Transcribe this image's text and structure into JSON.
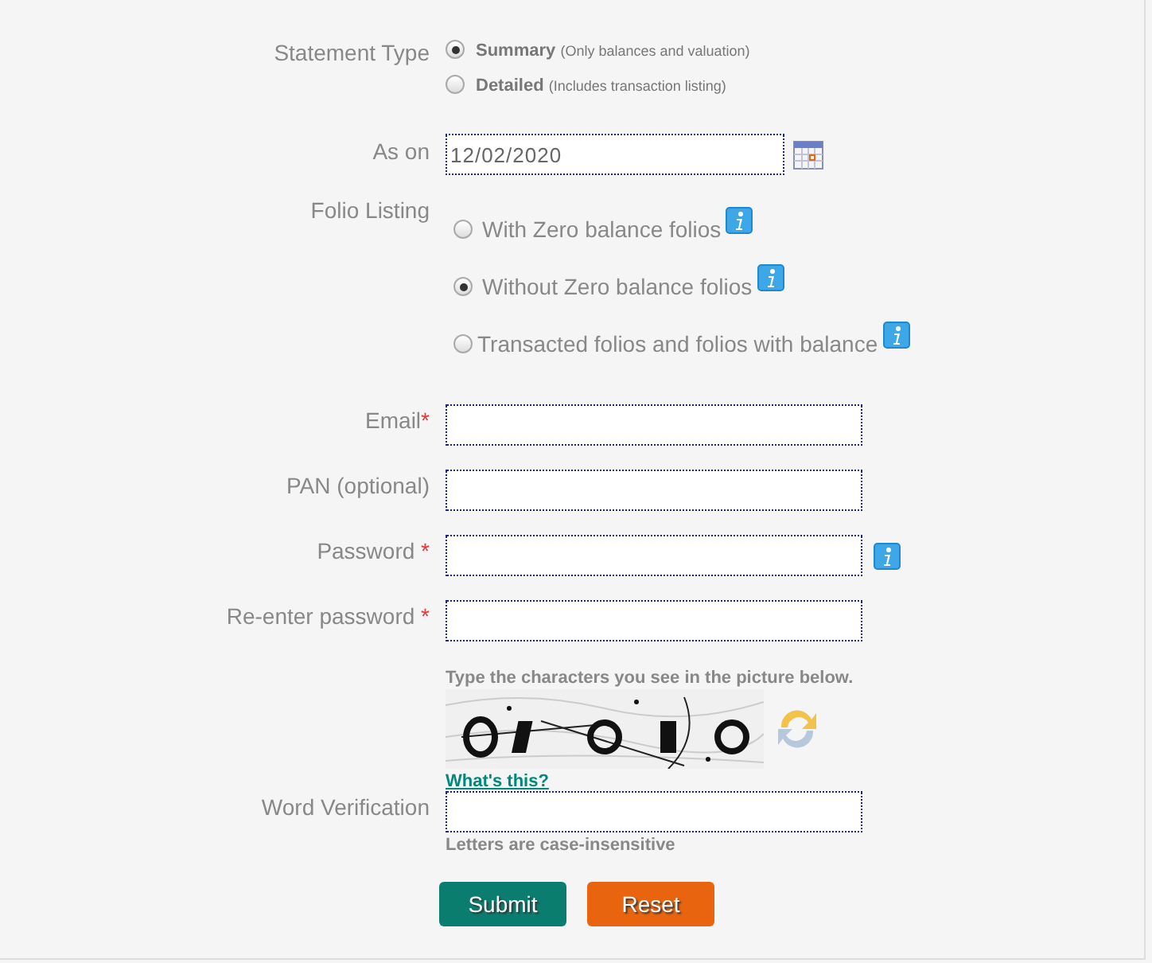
{
  "statement_type": {
    "label": "Statement Type",
    "options": [
      {
        "label": "Summary",
        "note": "(Only balances and valuation)",
        "selected": true
      },
      {
        "label": "Detailed",
        "note": "(Includes transaction listing)",
        "selected": false
      }
    ]
  },
  "as_on": {
    "label": "As on",
    "value": "12/02/2020"
  },
  "folio_listing": {
    "label": "Folio Listing",
    "options": [
      {
        "label": "With Zero balance folios",
        "selected": false
      },
      {
        "label": "Without Zero balance folios",
        "selected": true
      },
      {
        "label": "Transacted folios and folios with balance",
        "selected": false
      }
    ]
  },
  "fields": [
    {
      "label": "Email",
      "mark": "*",
      "info": false
    },
    {
      "label": "PAN (optional)",
      "info": false
    },
    {
      "label": "Password",
      "mark": "*",
      "info": true
    },
    {
      "label": "Re-enter password",
      "mark": "*",
      "info": false
    }
  ],
  "verification": {
    "caption": "Type the characters you see in the picture below.",
    "link": "What's this?",
    "label": "Word Verification",
    "hint": "Letters are case-insensitive"
  },
  "buttons": [
    {
      "label": "Submit",
      "kind": "submit"
    },
    {
      "label": "Reset",
      "kind": "reset"
    }
  ]
}
